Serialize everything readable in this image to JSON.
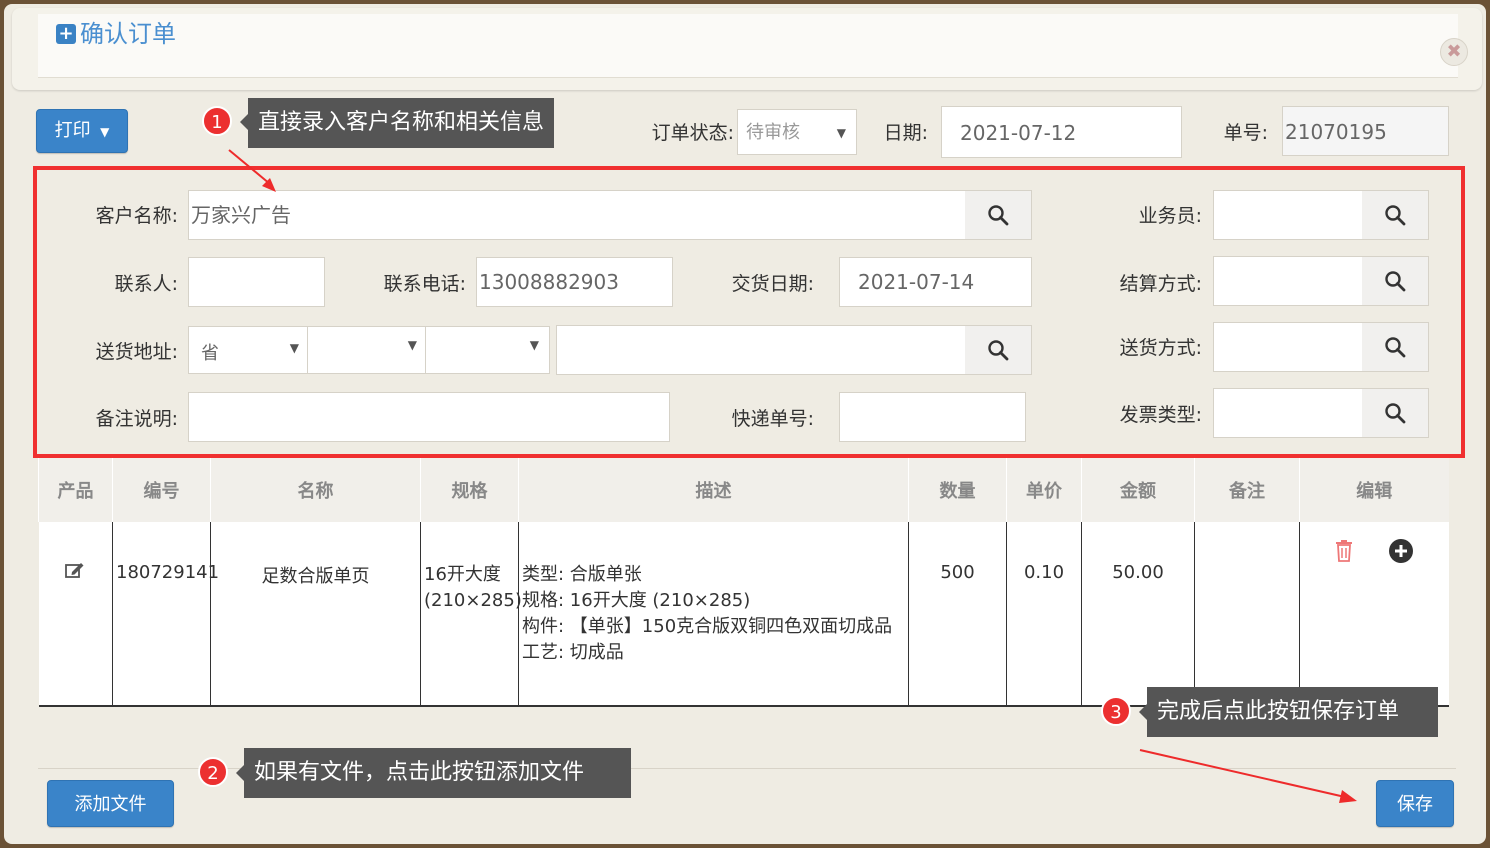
{
  "dialog": {
    "title": "确认订单",
    "close_icon": "close-icon"
  },
  "toolbar": {
    "print_label": "打印",
    "status_label": "订单状态:",
    "status_value": "待审核",
    "date_label": "日期:",
    "date_value": "2021-07-12",
    "order_no_label": "单号:",
    "order_no_value": "21070195"
  },
  "form": {
    "customer_label": "客户名称:",
    "customer_value": "万家兴广告",
    "salesman_label": "业务员:",
    "contact_label": "联系人:",
    "phone_label": "联系电话:",
    "phone_value": "13008882903",
    "delivery_date_label": "交货日期:",
    "delivery_date_value": "2021-07-14",
    "settlement_label": "结算方式:",
    "address_label": "送货地址:",
    "province_value": "省",
    "shipping_label": "送货方式:",
    "remark_label": "备注说明:",
    "express_label": "快递单号:",
    "invoice_label": "发票类型:"
  },
  "table": {
    "headers": [
      "产品",
      "编号",
      "名称",
      "规格",
      "描述",
      "数量",
      "单价",
      "金额",
      "备注",
      "编辑"
    ],
    "rows": [
      {
        "code": "180729141",
        "name": "足数合版单页",
        "spec_line1": "16开大度",
        "spec_line2": "(210×285)",
        "desc_lines": [
          "类型: 合版单张",
          "规格: 16开大度 (210×285)",
          "构件: 【单张】150克合版双铜四色双面切成品",
          "工艺: 切成品"
        ],
        "qty": "500",
        "price": "0.10",
        "amount": "50.00",
        "remark": ""
      }
    ]
  },
  "tips": {
    "tip1": "直接录入客户名称和相关信息",
    "badge1": "1",
    "tip2": "如果有文件，点击此按钮添加文件",
    "badge2": "2",
    "tip3": "完成后点此按钮保存订单",
    "badge3": "3"
  },
  "footer": {
    "add_file_label": "添加文件",
    "save_label": "保存"
  },
  "colors": {
    "accent": "#3a84c9",
    "highlight": "#f03030",
    "tooltip_bg": "#555555"
  }
}
